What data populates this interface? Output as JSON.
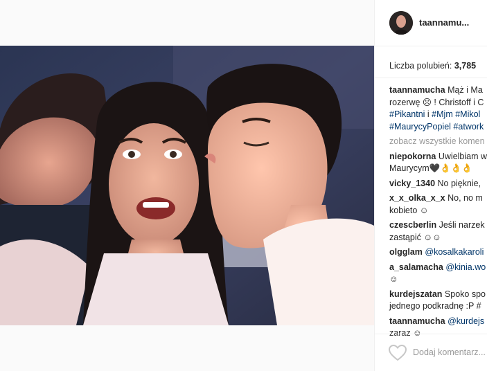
{
  "post": {
    "username": "taannamu...",
    "likes_label": "Liczba polubień: ",
    "likes_count": "3,785",
    "more_comments": "zobacz wszystkie komen",
    "add_comment_placeholder": "Dodaj komentarz..."
  },
  "caption": {
    "user": "taannamucha",
    "line1": "Mąż i Ma",
    "line2": "rozerwę ☹ ! Christoff i C",
    "line3_tag1": "#Pikantni",
    "line3_mid": " i ",
    "line3_tag2": "#Mjm",
    "line3_tag3": "#Mikol",
    "line4_tag1": "#MaurycyPopiel",
    "line4_tag2": "#atwork"
  },
  "comments": [
    {
      "user": "niepokorna",
      "text": "Uwielbiam w",
      "cont": "Maurycym🖤👌👌👌"
    },
    {
      "user": "vicky_1340",
      "text": "No pięknie,",
      "cont": ""
    },
    {
      "user": "x_x_olka_x_x",
      "text": "No, no m",
      "cont": "kobieto ☺"
    },
    {
      "user": "czescberlin",
      "text": "Jeśli narzek",
      "cont": "zastąpić ☺☺"
    },
    {
      "user": "olgglam",
      "mention": "@kosalkakaroli",
      "cont": ""
    },
    {
      "user": "a_salamacha",
      "mention": "@kinia.wo",
      "cont": "☺"
    },
    {
      "user": "kurdejszatan",
      "text": "Spoko spo",
      "cont": "jednego podkradnę :P #"
    },
    {
      "user": "taannamucha",
      "mention": "@kurdejs",
      "cont": "zaraz ☺"
    }
  ],
  "colors": {
    "follow_green": "#70c050",
    "hashtag": "#003569",
    "muted": "#999999",
    "text": "#262626"
  }
}
